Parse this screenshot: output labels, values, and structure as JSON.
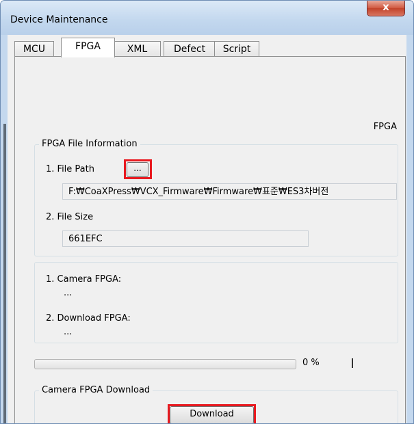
{
  "window": {
    "title": "Device Maintenance",
    "close_glyph": "x"
  },
  "tabs": [
    {
      "label": "MCU"
    },
    {
      "label": "FPGA",
      "active": true
    },
    {
      "label": "XML"
    },
    {
      "label": "Defect"
    },
    {
      "label": "Script"
    }
  ],
  "panel": {
    "caption": "FPGA",
    "file_info": {
      "legend": "FPGA File Information",
      "file_path_label": "1. File Path",
      "browse_label": "...",
      "file_path_value": "F:₩CoaXPress₩VCX_Firmware₩Firmware₩표준₩ES3차버전",
      "file_size_label": "2. File Size",
      "file_size_value": "661EFC"
    },
    "versions": {
      "camera_label": "1. Camera FPGA:",
      "camera_value": "...",
      "download_label": "2. Download FPGA:",
      "download_value": "..."
    },
    "progress": {
      "percent": 0,
      "text": "0 %"
    },
    "download": {
      "legend": "Camera FPGA Download",
      "button_label": "Download"
    }
  },
  "colors": {
    "highlight": "#e8191f",
    "close_button": "#c2432a"
  }
}
